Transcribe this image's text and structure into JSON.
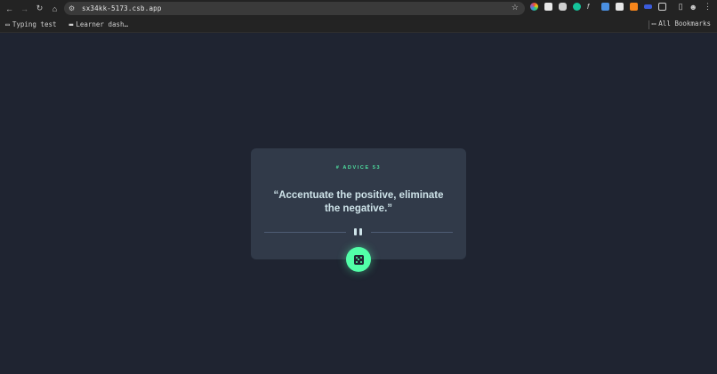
{
  "toolbar": {
    "url": "sx34kk-5173.csb.app",
    "back_icon": "←",
    "forward_icon": "→",
    "reload_icon": "↻",
    "home_icon": "⌂",
    "star_icon": "☆"
  },
  "bookmarks": {
    "items": [
      {
        "label": "Typing test",
        "icon": "folder-icon"
      },
      {
        "label": "Learner dash…",
        "icon": "favicon-icon"
      }
    ],
    "all_label": "All Bookmarks"
  },
  "advice": {
    "id_label": "# ADVICE 53",
    "quote": "“Accentuate the positive, eliminate the negative.”"
  },
  "colors": {
    "background": "#1f2431",
    "card": "#313a49",
    "accent": "#52ffa8",
    "text": "#cee3e9"
  }
}
